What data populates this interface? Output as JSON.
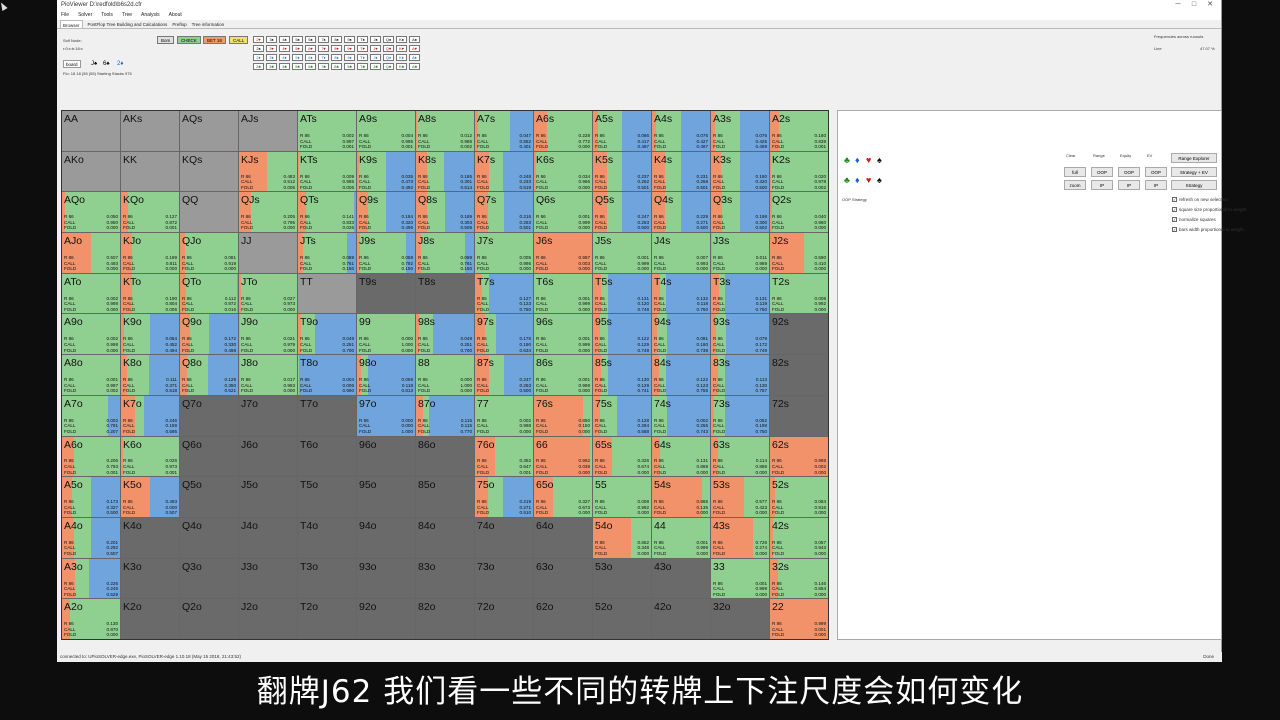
{
  "window": {
    "title": "PioViewer D:\\redfold\\b6s2d.cfr",
    "minimize": "─",
    "maximize": "□",
    "close": "✕"
  },
  "menu": [
    "File",
    "Solver",
    "Tools",
    "Tree",
    "Analysis",
    "About"
  ],
  "tabs": [
    "Browser",
    "PostFlop Tree Building and Calculations",
    "Preflop",
    "Tree information"
  ],
  "toolbar": {
    "left_lines": [
      "Solf Node:",
      "r:0:c:b:18:c",
      "",
      "Flo: 18 18 (55 (55) Starting Stacks 975"
    ],
    "board_label": "board",
    "board_cards": [
      "J♠",
      "6♠",
      "2♦"
    ],
    "actions": [
      {
        "label": "Bom",
        "color": "#e0e0e0"
      },
      {
        "label": "CHECK",
        "color": "#8fd08f"
      },
      {
        "label": "BET 18",
        "color": "#f09a6a"
      },
      {
        "label": "CALL",
        "color": "#f0e070"
      }
    ],
    "turn_cards_row1": [
      "2♥",
      "3♠",
      "4♠",
      "5♠",
      "6♠",
      "7♠",
      "8♠",
      "9♠",
      "T♠",
      "J♠",
      "Q♠",
      "K♠",
      "A♠"
    ],
    "turn_cards_row2": [
      "2♠",
      "3♥",
      "4♥",
      "5♥",
      "6♥",
      "7♥",
      "8♥",
      "9♥",
      "T♥",
      "J♥",
      "Q♥",
      "K♥",
      "A♥"
    ],
    "turn_cards_row3": [
      "2♦",
      "3♦",
      "4♦",
      "5♦",
      "6♦",
      "7♦",
      "8♦",
      "9♦",
      "T♦",
      "J♦",
      "Q♦",
      "K♦",
      "A♦"
    ],
    "turn_cards_row4": [
      "2♣",
      "3♣",
      "4♣",
      "5♣",
      "6♣",
      "7♣",
      "8♣",
      "9♣",
      "T♣",
      "J♣",
      "Q♣",
      "K♣",
      "A♣"
    ],
    "freq_label": "Frequencies across runouts",
    "line_label": "Line",
    "line_value": "47.07 %"
  },
  "colors": {
    "raise": "#f2926a",
    "call": "#8fcf8f",
    "fold": "#6fa4dc",
    "empty": "#6a6a6a",
    "full": "#9a9a9a"
  },
  "grid": [
    [
      {
        "h": "AA",
        "f": 1
      },
      {
        "h": "AKs",
        "f": 1
      },
      {
        "h": "AQs",
        "f": 1
      },
      {
        "h": "AJs",
        "f": 1
      },
      {
        "h": "ATs",
        "r": 0.002,
        "c": 0.997,
        "f": 0.001
      },
      {
        "h": "A9s",
        "r": 0.004,
        "c": 0.995,
        "f": 0.001
      },
      {
        "h": "A8s",
        "r": 0.012,
        "c": 0.986,
        "f": 0.002
      },
      {
        "h": "A7s",
        "r": 0.047,
        "c": 0.552,
        "f": 0.401
      },
      {
        "h": "A6s",
        "r": 0.228,
        "c": 0.772,
        "f": 0.0
      },
      {
        "h": "A5s",
        "r": 0.086,
        "c": 0.417,
        "f": 0.497
      },
      {
        "h": "A4s",
        "r": 0.076,
        "c": 0.427,
        "f": 0.497
      },
      {
        "h": "A3s",
        "r": 0.076,
        "c": 0.425,
        "f": 0.499
      },
      {
        "h": "A2s",
        "r": 0.16,
        "c": 0.839,
        "f": 0.001
      }
    ],
    [
      {
        "h": "AKo",
        "f": 1
      },
      {
        "h": "KK",
        "f": 1
      },
      {
        "h": "KQs",
        "f": 1
      },
      {
        "h": "KJs",
        "r": 0.483,
        "c": 0.512,
        "f": 0.005
      },
      {
        "h": "KTs",
        "r": 0.009,
        "c": 0.985,
        "f": 0.006
      },
      {
        "h": "K9s",
        "r": 0.035,
        "c": 0.473,
        "f": 0.492
      },
      {
        "h": "K8s",
        "r": 0.185,
        "c": 0.301,
        "f": 0.514
      },
      {
        "h": "K7s",
        "r": 0.248,
        "c": 0.233,
        "f": 0.519
      },
      {
        "h": "K6s",
        "r": 0.034,
        "c": 0.966,
        "f": 0.0
      },
      {
        "h": "K5s",
        "r": 0.237,
        "c": 0.262,
        "f": 0.501
      },
      {
        "h": "K4s",
        "r": 0.231,
        "c": 0.268,
        "f": 0.501
      },
      {
        "h": "K3s",
        "r": 0.18,
        "c": 0.32,
        "f": 0.5
      },
      {
        "h": "K2s",
        "r": 0.02,
        "c": 0.978,
        "f": 0.002
      }
    ],
    [
      {
        "h": "AQo",
        "r": 0.05,
        "c": 0.95,
        "f": 0.0
      },
      {
        "h": "KQo",
        "r": 0.127,
        "c": 0.872,
        "f": 0.001
      },
      {
        "h": "QQ",
        "f": 1
      },
      {
        "h": "QJs",
        "r": 0.205,
        "c": 0.795,
        "f": 0.0
      },
      {
        "h": "QTs",
        "r": 0.141,
        "c": 0.833,
        "f": 0.026
      },
      {
        "h": "Q9s",
        "r": 0.184,
        "c": 0.32,
        "f": 0.496
      },
      {
        "h": "Q8s",
        "r": 0.189,
        "c": 0.303,
        "f": 0.508
      },
      {
        "h": "Q7s",
        "r": 0.216,
        "c": 0.283,
        "f": 0.501
      },
      {
        "h": "Q6s",
        "r": 0.001,
        "c": 0.999,
        "f": 0.0
      },
      {
        "h": "Q5s",
        "r": 0.247,
        "c": 0.253,
        "f": 0.5
      },
      {
        "h": "Q4s",
        "r": 0.229,
        "c": 0.271,
        "f": 0.5
      },
      {
        "h": "Q3s",
        "r": 0.198,
        "c": 0.3,
        "f": 0.502
      },
      {
        "h": "Q2s",
        "r": 0.04,
        "c": 0.96,
        "f": 0.0
      }
    ],
    [
      {
        "h": "AJo",
        "r": 0.507,
        "c": 0.493,
        "f": 0.0
      },
      {
        "h": "KJo",
        "r": 0.189,
        "c": 0.811,
        "f": 0.0
      },
      {
        "h": "QJo",
        "r": 0.081,
        "c": 0.919,
        "f": 0.0
      },
      {
        "h": "JJ",
        "f": 1
      },
      {
        "h": "JTs",
        "r": 0.089,
        "c": 0.761,
        "f": 0.15
      },
      {
        "h": "J9s",
        "r": 0.058,
        "c": 0.792,
        "f": 0.15
      },
      {
        "h": "J8s",
        "r": 0.089,
        "c": 0.761,
        "f": 0.15
      },
      {
        "h": "J7s",
        "r": 0.005,
        "c": 0.995,
        "f": 0.0
      },
      {
        "h": "J6s",
        "r": 0.997,
        "c": 0.003,
        "f": 0.0
      },
      {
        "h": "J5s",
        "r": 0.001,
        "c": 0.999,
        "f": 0.0
      },
      {
        "h": "J4s",
        "r": 0.007,
        "c": 0.993,
        "f": 0.0
      },
      {
        "h": "J3s",
        "r": 0.011,
        "c": 0.989,
        "f": 0.0
      },
      {
        "h": "J2s",
        "r": 0.59,
        "c": 0.41,
        "f": 0.0
      }
    ],
    [
      {
        "h": "ATo",
        "r": 0.002,
        "c": 0.998,
        "f": 0.0
      },
      {
        "h": "KTo",
        "r": 0.19,
        "c": 0.804,
        "f": 0.006
      },
      {
        "h": "QTo",
        "r": 0.112,
        "c": 0.872,
        "f": 0.016
      },
      {
        "h": "JTo",
        "r": 0.027,
        "c": 0.973,
        "f": 0.0
      },
      {
        "h": "TT",
        "f": 1
      },
      {
        "h": "T9s",
        "f": 0
      },
      {
        "h": "T8s",
        "f": 0
      },
      {
        "h": "T7s",
        "r": 0.127,
        "c": 0.123,
        "f": 0.75
      },
      {
        "h": "T6s",
        "r": 0.001,
        "c": 0.999,
        "f": 0.0
      },
      {
        "h": "T5s",
        "r": 0.131,
        "c": 0.12,
        "f": 0.749
      },
      {
        "h": "T4s",
        "r": 0.132,
        "c": 0.118,
        "f": 0.75
      },
      {
        "h": "T3s",
        "r": 0.131,
        "c": 0.119,
        "f": 0.75
      },
      {
        "h": "T2s",
        "r": 0.008,
        "c": 0.992,
        "f": 0.0
      }
    ],
    [
      {
        "h": "A9o",
        "r": 0.002,
        "c": 0.998,
        "f": 0.0
      },
      {
        "h": "K9o",
        "r": 0.054,
        "c": 0.452,
        "f": 0.494
      },
      {
        "h": "Q9o",
        "r": 0.172,
        "c": 0.33,
        "f": 0.498
      },
      {
        "h": "J9o",
        "r": 0.021,
        "c": 0.979,
        "f": 0.0
      },
      {
        "h": "T9o",
        "r": 0.049,
        "c": 0.251,
        "f": 0.7
      },
      {
        "h": "99",
        "r": 0.0,
        "c": 1.0,
        "f": 0.0
      },
      {
        "h": "98s",
        "r": 0.049,
        "c": 0.251,
        "f": 0.7
      },
      {
        "h": "97s",
        "r": 0.176,
        "c": 0.19,
        "f": 0.634
      },
      {
        "h": "96s",
        "r": 0.001,
        "c": 0.999,
        "f": 0.0
      },
      {
        "h": "95s",
        "r": 0.122,
        "c": 0.129,
        "f": 0.749
      },
      {
        "h": "94s",
        "r": 0.081,
        "c": 0.18,
        "f": 0.739
      },
      {
        "h": "93s",
        "r": 0.079,
        "c": 0.172,
        "f": 0.749
      },
      {
        "h": "92s",
        "f": 0
      }
    ],
    [
      {
        "h": "A8o",
        "r": 0.001,
        "c": 0.997,
        "f": 0.002
      },
      {
        "h": "K8o",
        "r": 0.111,
        "c": 0.371,
        "f": 0.518
      },
      {
        "h": "Q8o",
        "r": 0.129,
        "c": 0.35,
        "f": 0.521
      },
      {
        "h": "J8o",
        "r": 0.017,
        "c": 0.983,
        "f": 0.0
      },
      {
        "h": "T8o",
        "r": 0.004,
        "c": 0.006,
        "f": 0.99
      },
      {
        "h": "98o",
        "r": 0.069,
        "c": 0.118,
        "f": 0.813
      },
      {
        "h": "88",
        "r": 0.0,
        "c": 1.0,
        "f": 0.0
      },
      {
        "h": "87s",
        "r": 0.247,
        "c": 0.253,
        "f": 0.5
      },
      {
        "h": "86s",
        "r": 0.001,
        "c": 0.999,
        "f": 0.0
      },
      {
        "h": "85s",
        "r": 0.13,
        "c": 0.129,
        "f": 0.741
      },
      {
        "h": "84s",
        "r": 0.122,
        "c": 0.123,
        "f": 0.755
      },
      {
        "h": "83s",
        "r": 0.113,
        "c": 0.13,
        "f": 0.757
      },
      {
        "h": "82s",
        "f": 0
      }
    ],
    [
      {
        "h": "A7o",
        "r": 0.002,
        "c": 0.791,
        "f": 0.207
      },
      {
        "h": "K7o",
        "r": 0.246,
        "c": 0.159,
        "f": 0.595
      },
      {
        "h": "Q7o",
        "f": 0
      },
      {
        "h": "J7o",
        "f": 0
      },
      {
        "h": "T7o",
        "f": 0
      },
      {
        "h": "97o",
        "r": 0.0,
        "c": 0.0,
        "f": 1.0
      },
      {
        "h": "87o",
        "r": 0.115,
        "c": 0.115,
        "f": 0.77
      },
      {
        "h": "77",
        "r": 0.002,
        "c": 0.998,
        "f": 0.0
      },
      {
        "h": "76s",
        "r": 0.85,
        "c": 0.15,
        "f": 0.0
      },
      {
        "h": "75s",
        "r": 0.128,
        "c": 0.284,
        "f": 0.588
      },
      {
        "h": "74s",
        "r": 0.002,
        "c": 0.255,
        "f": 0.743
      },
      {
        "h": "73s",
        "r": 0.052,
        "c": 0.198,
        "f": 0.75
      },
      {
        "h": "72s",
        "f": 0
      }
    ],
    [
      {
        "h": "A6o",
        "r": 0.206,
        "c": 0.793,
        "f": 0.001
      },
      {
        "h": "K6o",
        "r": 0.026,
        "c": 0.973,
        "f": 0.001
      },
      {
        "h": "Q6o",
        "f": 0
      },
      {
        "h": "J6o",
        "f": 0
      },
      {
        "h": "T6o",
        "f": 0
      },
      {
        "h": "96o",
        "f": 0
      },
      {
        "h": "86o",
        "f": 0
      },
      {
        "h": "76o",
        "r": 0.352,
        "c": 0.647,
        "f": 0.001
      },
      {
        "h": "66",
        "r": 0.962,
        "c": 0.038,
        "f": 0.0
      },
      {
        "h": "65s",
        "r": 0.326,
        "c": 0.674,
        "f": 0.0
      },
      {
        "h": "64s",
        "r": 0.131,
        "c": 0.869,
        "f": 0.0
      },
      {
        "h": "63s",
        "r": 0.114,
        "c": 0.886,
        "f": 0.0
      },
      {
        "h": "62s",
        "r": 0.998,
        "c": 0.002,
        "f": 0.0
      }
    ],
    [
      {
        "h": "A5o",
        "r": 0.173,
        "c": 0.327,
        "f": 0.5
      },
      {
        "h": "K5o",
        "r": 0.493,
        "c": 0.0,
        "f": 0.507
      },
      {
        "h": "Q5o",
        "f": 0
      },
      {
        "h": "J5o",
        "f": 0
      },
      {
        "h": "T5o",
        "f": 0
      },
      {
        "h": "95o",
        "f": 0
      },
      {
        "h": "85o",
        "f": 0
      },
      {
        "h": "75o",
        "r": 0.219,
        "c": 0.271,
        "f": 0.51
      },
      {
        "h": "65o",
        "r": 0.327,
        "c": 0.673,
        "f": 0.0
      },
      {
        "h": "55",
        "r": 0.008,
        "c": 0.992,
        "f": 0.0
      },
      {
        "h": "54s",
        "r": 0.865,
        "c": 0.135,
        "f": 0.0
      },
      {
        "h": "53s",
        "r": 0.577,
        "c": 0.423,
        "f": 0.0
      },
      {
        "h": "52s",
        "r": 0.084,
        "c": 0.916,
        "f": 0.0
      }
    ],
    [
      {
        "h": "A4o",
        "r": 0.201,
        "c": 0.292,
        "f": 0.507
      },
      {
        "h": "K4o",
        "f": 0
      },
      {
        "h": "Q4o",
        "f": 0
      },
      {
        "h": "J4o",
        "f": 0
      },
      {
        "h": "T4o",
        "f": 0
      },
      {
        "h": "94o",
        "f": 0
      },
      {
        "h": "84o",
        "f": 0
      },
      {
        "h": "74o",
        "f": 0
      },
      {
        "h": "64o",
        "f": 0
      },
      {
        "h": "54o",
        "r": 0.652,
        "c": 0.348,
        "f": 0.0
      },
      {
        "h": "44",
        "r": 0.001,
        "c": 0.999,
        "f": 0.0
      },
      {
        "h": "43s",
        "r": 0.726,
        "c": 0.274,
        "f": 0.0
      },
      {
        "h": "42s",
        "r": 0.057,
        "c": 0.943,
        "f": 0.0
      }
    ],
    [
      {
        "h": "A3o",
        "r": 0.226,
        "c": 0.245,
        "f": 0.529
      },
      {
        "h": "K3o",
        "f": 0
      },
      {
        "h": "Q3o",
        "f": 0
      },
      {
        "h": "J3o",
        "f": 0
      },
      {
        "h": "T3o",
        "f": 0
      },
      {
        "h": "93o",
        "f": 0
      },
      {
        "h": "83o",
        "f": 0
      },
      {
        "h": "73o",
        "f": 0
      },
      {
        "h": "63o",
        "f": 0
      },
      {
        "h": "53o",
        "f": 0
      },
      {
        "h": "43o",
        "f": 0
      },
      {
        "h": "33",
        "r": 0.001,
        "c": 0.999,
        "f": 0.0
      },
      {
        "h": "32s",
        "r": 0.146,
        "c": 0.854,
        "f": 0.0
      }
    ],
    [
      {
        "h": "A2o",
        "r": 0.13,
        "c": 0.87,
        "f": 0.0
      },
      {
        "h": "K2o",
        "f": 0
      },
      {
        "h": "Q2o",
        "f": 0
      },
      {
        "h": "J2o",
        "f": 0
      },
      {
        "h": "T2o",
        "f": 0
      },
      {
        "h": "92o",
        "f": 0
      },
      {
        "h": "82o",
        "f": 0
      },
      {
        "h": "72o",
        "f": 0
      },
      {
        "h": "62o",
        "f": 0
      },
      {
        "h": "52o",
        "f": 0
      },
      {
        "h": "42o",
        "f": 0
      },
      {
        "h": "32o",
        "f": 0
      },
      {
        "h": "22",
        "r": 0.999,
        "c": 0.001,
        "f": 0.0
      }
    ]
  ],
  "labels": {
    "r": "R 86",
    "c": "CALL",
    "f": "FOLD"
  },
  "right_panel": {
    "suits_row1": [
      "♣",
      "♦",
      "♥",
      "♠"
    ],
    "suits_row2": [
      "♣",
      "♦",
      "♥",
      "♠"
    ],
    "strategy_label": "OOP Strategy",
    "header_labels": [
      "Clear",
      "Range",
      "Equity",
      "EV"
    ],
    "btn_range_explorer": "Range Explorer",
    "btn_full": "full",
    "btn_zoom": "zoom",
    "btn_oop1": "OOP",
    "btn_ip1": "IP",
    "btn_oop2": "OOP",
    "btn_ip2": "IP",
    "btn_oop3": "OOP",
    "btn_ip3": "IP",
    "btn_strat_ev": "Strategy + EV",
    "btn_strategy": "Strategy",
    "checkboxes": [
      "refresh on new selection",
      "square size proportional to weight",
      "normalize squares",
      "bars width proportional to weight"
    ]
  },
  "status": {
    "left": "connected to: UPioSOLVER-edge.exe, PioSOLVER-edge 1.10.18 (May 15 2018, 21:43:52)",
    "right": "Done"
  },
  "subtitle": "翻牌J62 我们看一些不同的转牌上下注尺度会如何变化"
}
